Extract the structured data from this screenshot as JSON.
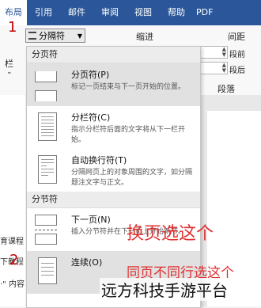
{
  "ribbon": {
    "tabs": [
      "布局",
      "引用",
      "邮件",
      "审阅",
      "视图",
      "帮助",
      "PDF"
    ],
    "active_tab": "布局",
    "separator_button": "分隔符",
    "indent_label": "缩进",
    "spacing_label": "间距",
    "para_before": "段前",
    "para_after": "段后",
    "paragraph_group": "段落",
    "left_label": "栏",
    "left_chevron": "⌄"
  },
  "menu": {
    "page_section": "分页符",
    "section_section": "分节符",
    "items": [
      {
        "title": "分页符(P)",
        "desc": "标记一页结束与下一页开始的位置。"
      },
      {
        "title": "分栏符(C)",
        "desc": "指示分栏符后面的文字将从下一栏开始。"
      },
      {
        "title": "自动换行符(T)",
        "desc": "分隔网页上的对象周围的文字，如分隔题注文字与正文。"
      },
      {
        "title": "下一页(N)",
        "desc": "插入分节符并在下一页上开始新节。"
      },
      {
        "title": "连续(O)",
        "desc": ""
      }
    ]
  },
  "annotations": {
    "num1": "1",
    "num2": "2",
    "next_page_note": "换页选这个",
    "same_page_note": "同页不同行选这个"
  },
  "left_partial": {
    "line1": "育课程",
    "line2": "下教程",
    "line3": "·\" 内容"
  },
  "watermark": "远方科技手游平台"
}
